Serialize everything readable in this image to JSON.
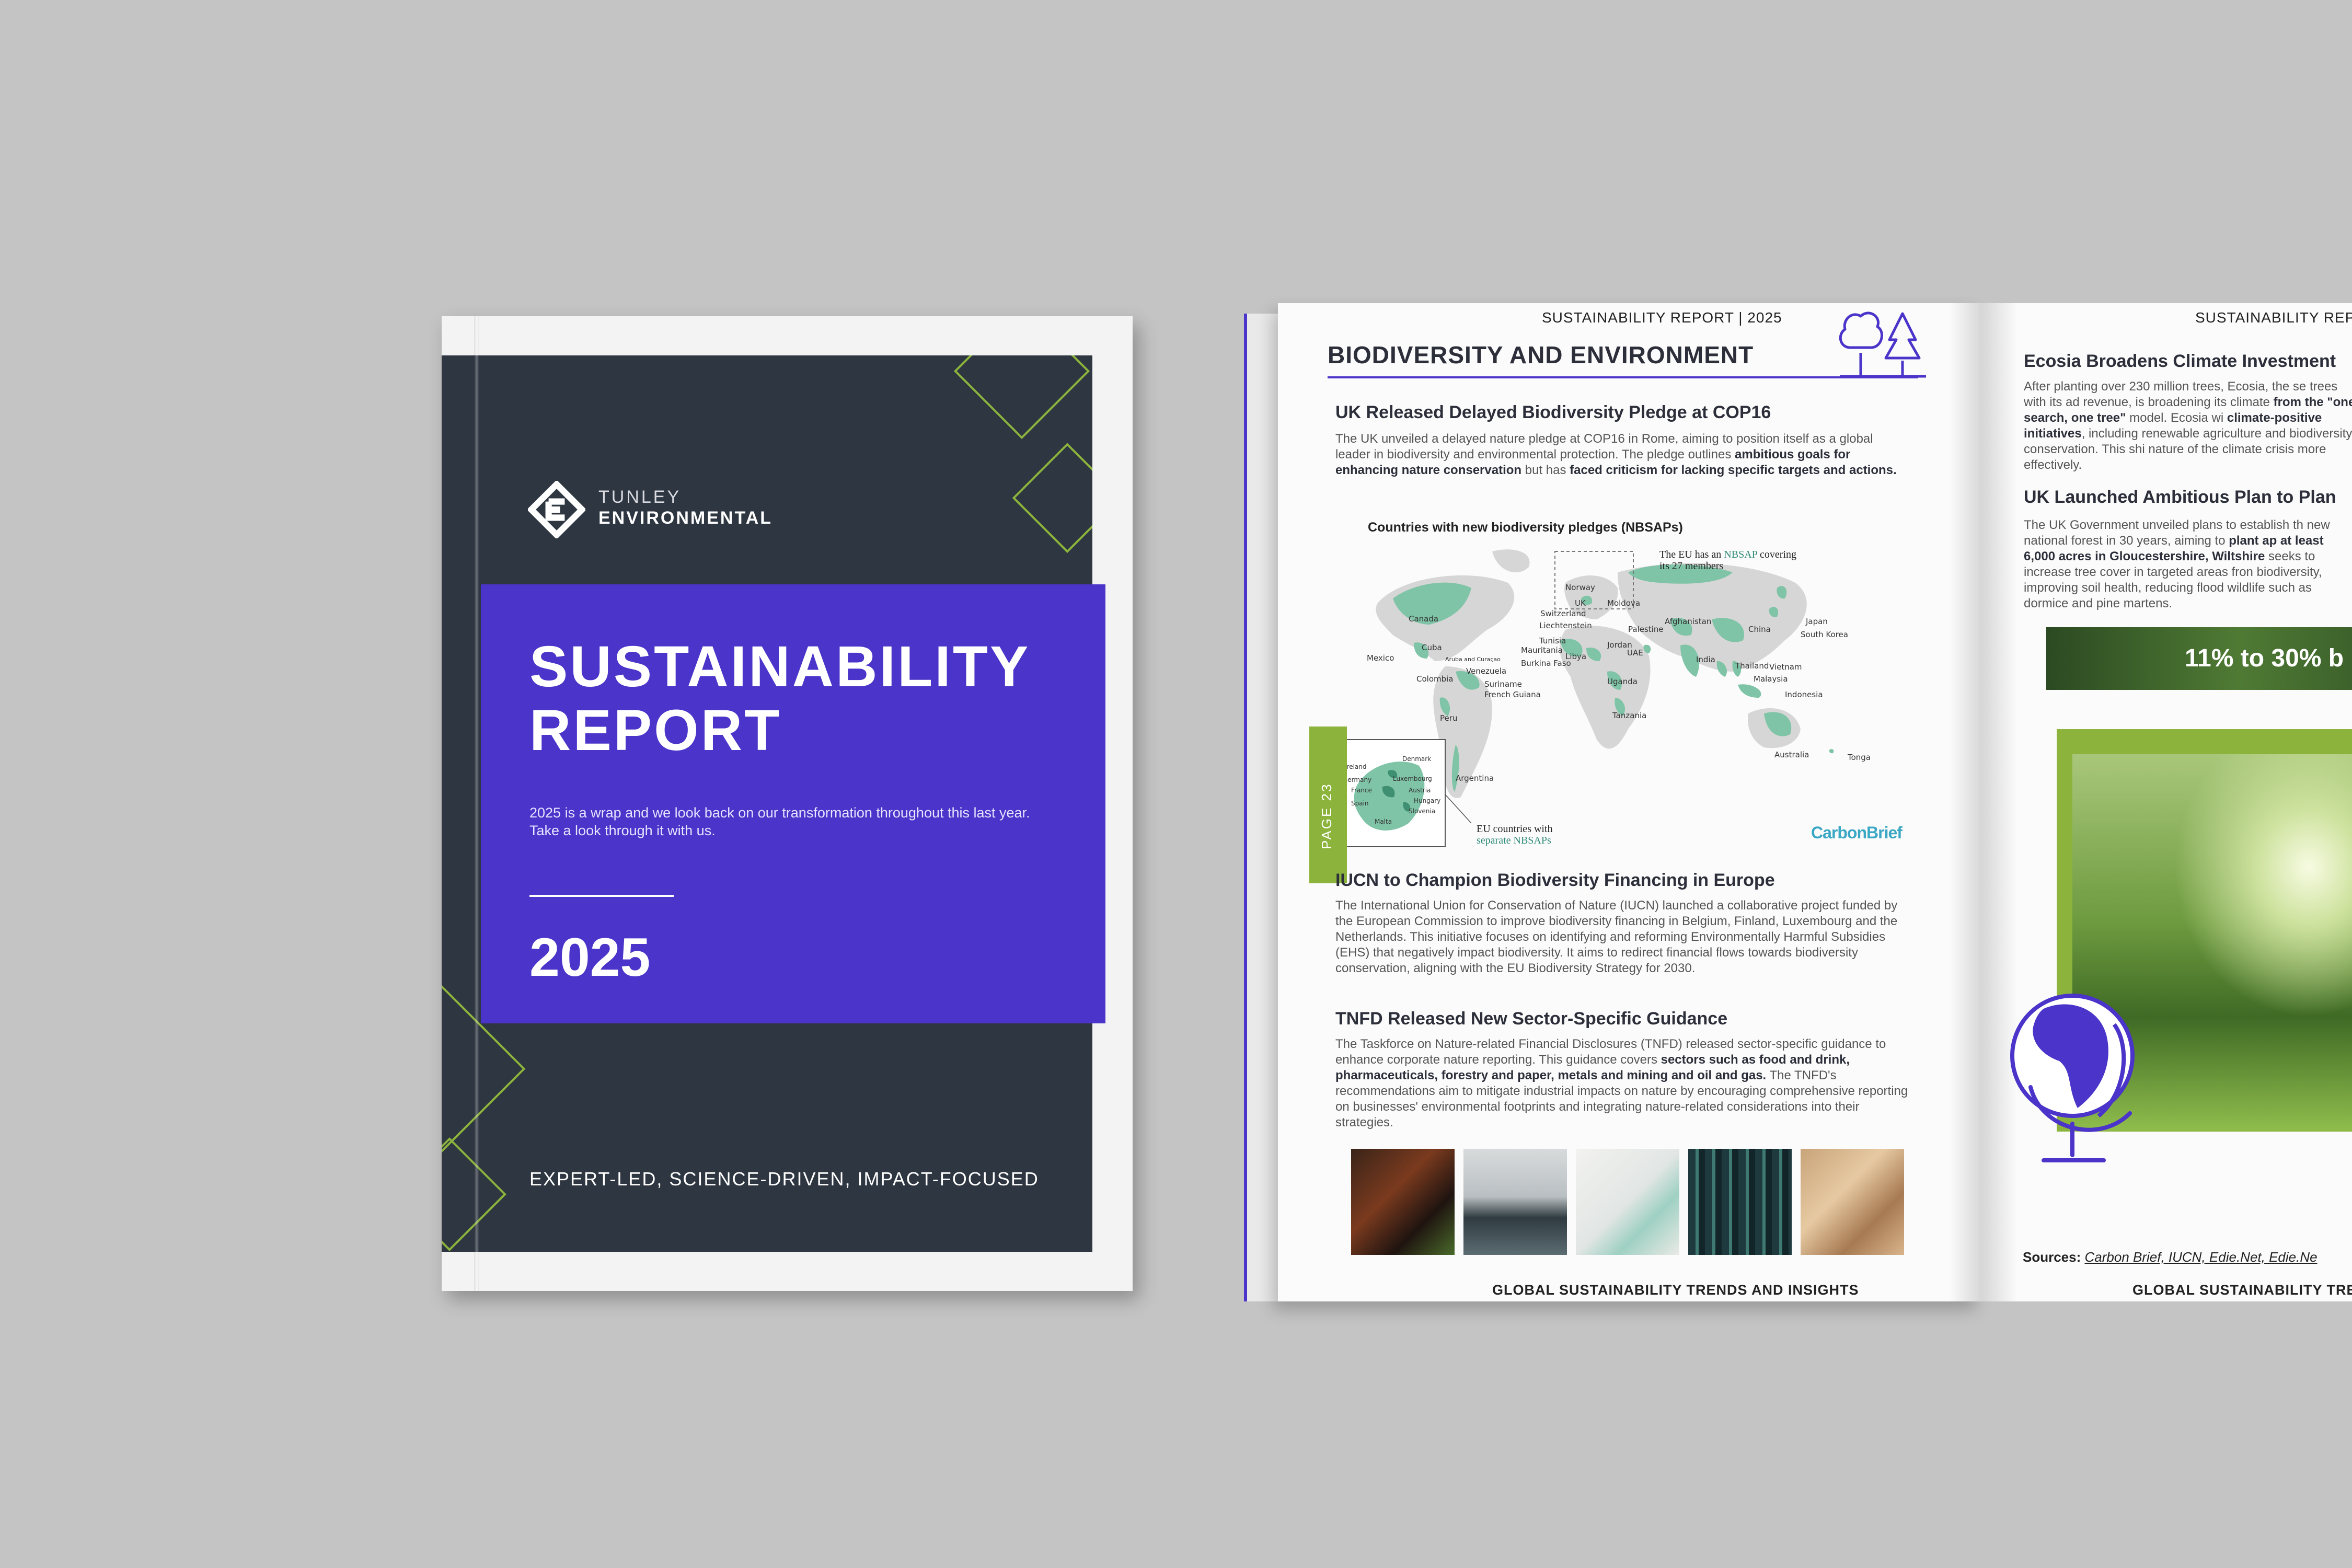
{
  "cover": {
    "brand_line1": "TUNLEY",
    "brand_line2": "ENVIRONMENTAL",
    "title_line1": "SUSTAINABILITY",
    "title_line2": "REPORT",
    "subtitle": "2025 is a wrap and we look back on our transformation throughout this last year. Take a look through it with us.",
    "year": "2025",
    "tagline": "EXPERT-LED, SCIENCE-DRIVEN, IMPACT-FOCUSED",
    "colors": {
      "panel": "#2e3641",
      "band": "#4a34c9",
      "accent": "#8cb43c"
    }
  },
  "left_page": {
    "running_head": "SUSTAINABILITY REPORT | 2025",
    "section_title": "BIODIVERSITY AND ENVIRONMENT",
    "page_label": "PAGE 23",
    "footer": "GLOBAL SUSTAINABILITY TRENDS AND INSIGHTS",
    "articles": [
      {
        "heading": "UK Released Delayed Biodiversity Pledge at COP16",
        "body_plain1": "The UK unveiled a delayed nature pledge at COP16 in Rome, aiming to position itself as a global leader in biodiversity and environmental protection. The pledge outlines ",
        "body_bold1": "ambitious goals for enhancing nature conservation",
        "body_plain2": " but has ",
        "body_bold2": "faced criticism for lacking specific targets and actions."
      },
      {
        "heading": "IUCN to Champion Biodiversity Financing in Europe",
        "body": "The International Union for Conservation of Nature (IUCN) launched a collaborative project funded by the European Commission to improve biodiversity financing in Belgium, Finland, Luxembourg and the Netherlands. This initiative focuses on identifying and reforming Environmentally Harmful Subsidies (EHS) that negatively impact biodiversity. It aims to redirect financial flows towards biodiversity conservation, aligning with the EU Biodiversity Strategy for 2030."
      },
      {
        "heading": "TNFD Released New Sector-Specific Guidance",
        "body_plain1": "The Taskforce on Nature-related Financial Disclosures (TNFD) released sector-specific guidance to enhance corporate nature reporting. This guidance covers ",
        "body_bold1": "sectors such as food and drink, pharmaceuticals, forestry and paper, metals and mining and oil and gas.",
        "body_plain2": " The TNFD's recommendations aim to mitigate industrial impacts on nature by encouraging comprehensive reporting on businesses' environmental footprints and integrating nature-related considerations into their strategies."
      }
    ],
    "map": {
      "title": "Countries with new biodiversity pledges (NBSAPs)",
      "eu_note_pre": "The EU has an ",
      "eu_note_highlight": "NBSAP",
      "eu_note_post": " covering its 27 members",
      "inset_note_line1": "EU countries with",
      "inset_note_line2": "separate NBSAPs",
      "brand": "CarbonBrief",
      "labels": [
        "Canada",
        "Norway",
        "UK",
        "Switzerland",
        "Liechtenstein",
        "Moldova",
        "Palestine",
        "Afghanistan",
        "Japan",
        "South Korea",
        "China",
        "Mexico",
        "Cuba",
        "Aruba and Curaçao",
        "Mauritania",
        "Tunisia",
        "Burkina Faso",
        "Libya",
        "Jordan",
        "UAE",
        "India",
        "Thailand",
        "Vietnam",
        "Malaysia",
        "Colombia",
        "Venezuela",
        "Suriname",
        "French Guiana",
        "Uganda",
        "Tanzania",
        "Indonesia",
        "Peru",
        "Australia",
        "Tonga",
        "Argentina",
        "Ireland",
        "Denmark",
        "Germany",
        "Luxembourg",
        "Austria",
        "France",
        "Hungary",
        "Spain",
        "Slovenia",
        "Malta"
      ]
    }
  },
  "right_page": {
    "running_head": "SUSTAINABILITY REP",
    "footer": "GLOBAL SUSTAINABILITY TRE",
    "article1_heading": "Ecosia Broadens Climate Investment",
    "article1_body_plain1": "After planting over 230 million trees, Ecosia, the se trees with its ad revenue, is broadening its climate ",
    "article1_body_bold1": "from the \"one search, one tree\"",
    "article1_body_plain2": " model. Ecosia wi ",
    "article1_body_bold2": "climate-positive initiatives",
    "article1_body_plain3": ", including renewable agriculture and biodiversity conservation. This shi nature of the climate crisis more effectively.",
    "article2_heading": "UK Launched Ambitious Plan to Plan",
    "article2_body_plain1": "The UK Government unveiled plans to establish th new national forest in 30 years, aiming to ",
    "article2_body_bold1": "plant ap at least 6,000 acres in Gloucestershire, Wiltshire",
    "article2_body_plain2": " seeks to increase tree cover in targeted areas fron biodiversity, improving soil health, reducing flood wildlife such as dormice and pine martens.",
    "banner": "11% to 30% b",
    "sources_label": "Sources:",
    "sources_list": "Carbon Brief, IUCN, Edie.Net, Edie.Ne"
  }
}
